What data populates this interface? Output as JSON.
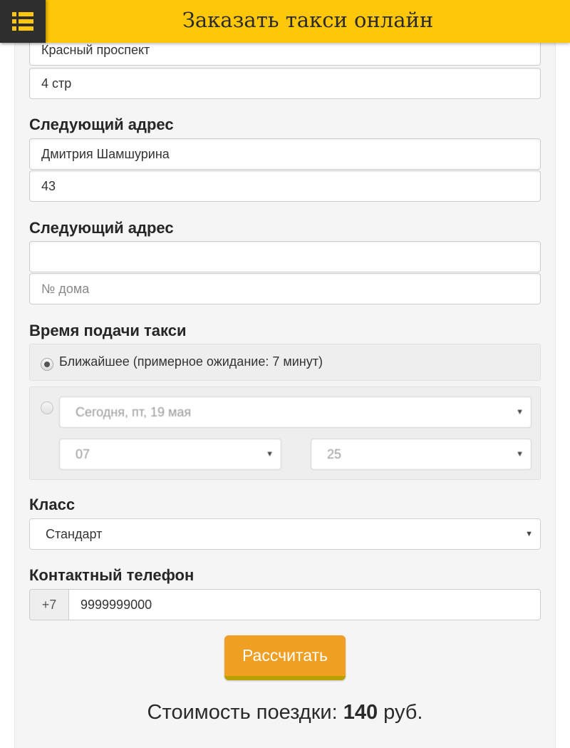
{
  "header": {
    "title": "Заказать такси онлайн",
    "menu_icon": "menu-list-icon",
    "bar_color": "#fec708"
  },
  "address_from": {
    "street_value": "Красный проспект",
    "house_value": "4 стр"
  },
  "next_address_1": {
    "label": "Следующий адрес",
    "street_value": "Дмитрия Шамшурина",
    "house_value": "43"
  },
  "next_address_2": {
    "label": "Следующий адрес",
    "street_value": "",
    "house_placeholder": "№ дома"
  },
  "pickup_time": {
    "label": "Время подачи такси",
    "option_nearest": "Ближайшее (примерное ожидание: 7 минут)",
    "date_value": "Сегодня, пт, 19 мая",
    "hour_value": "07",
    "minute_value": "25"
  },
  "car_class": {
    "label": "Класс",
    "value": "Стандарт"
  },
  "phone": {
    "label": "Контактный телефон",
    "prefix": "+7",
    "value": "9999999000"
  },
  "calculate_button": {
    "label": "Рассчитать",
    "color": "#ef9f22"
  },
  "price": {
    "prefix": "Стоимость поездки:",
    "amount": "140",
    "currency": "руб."
  }
}
